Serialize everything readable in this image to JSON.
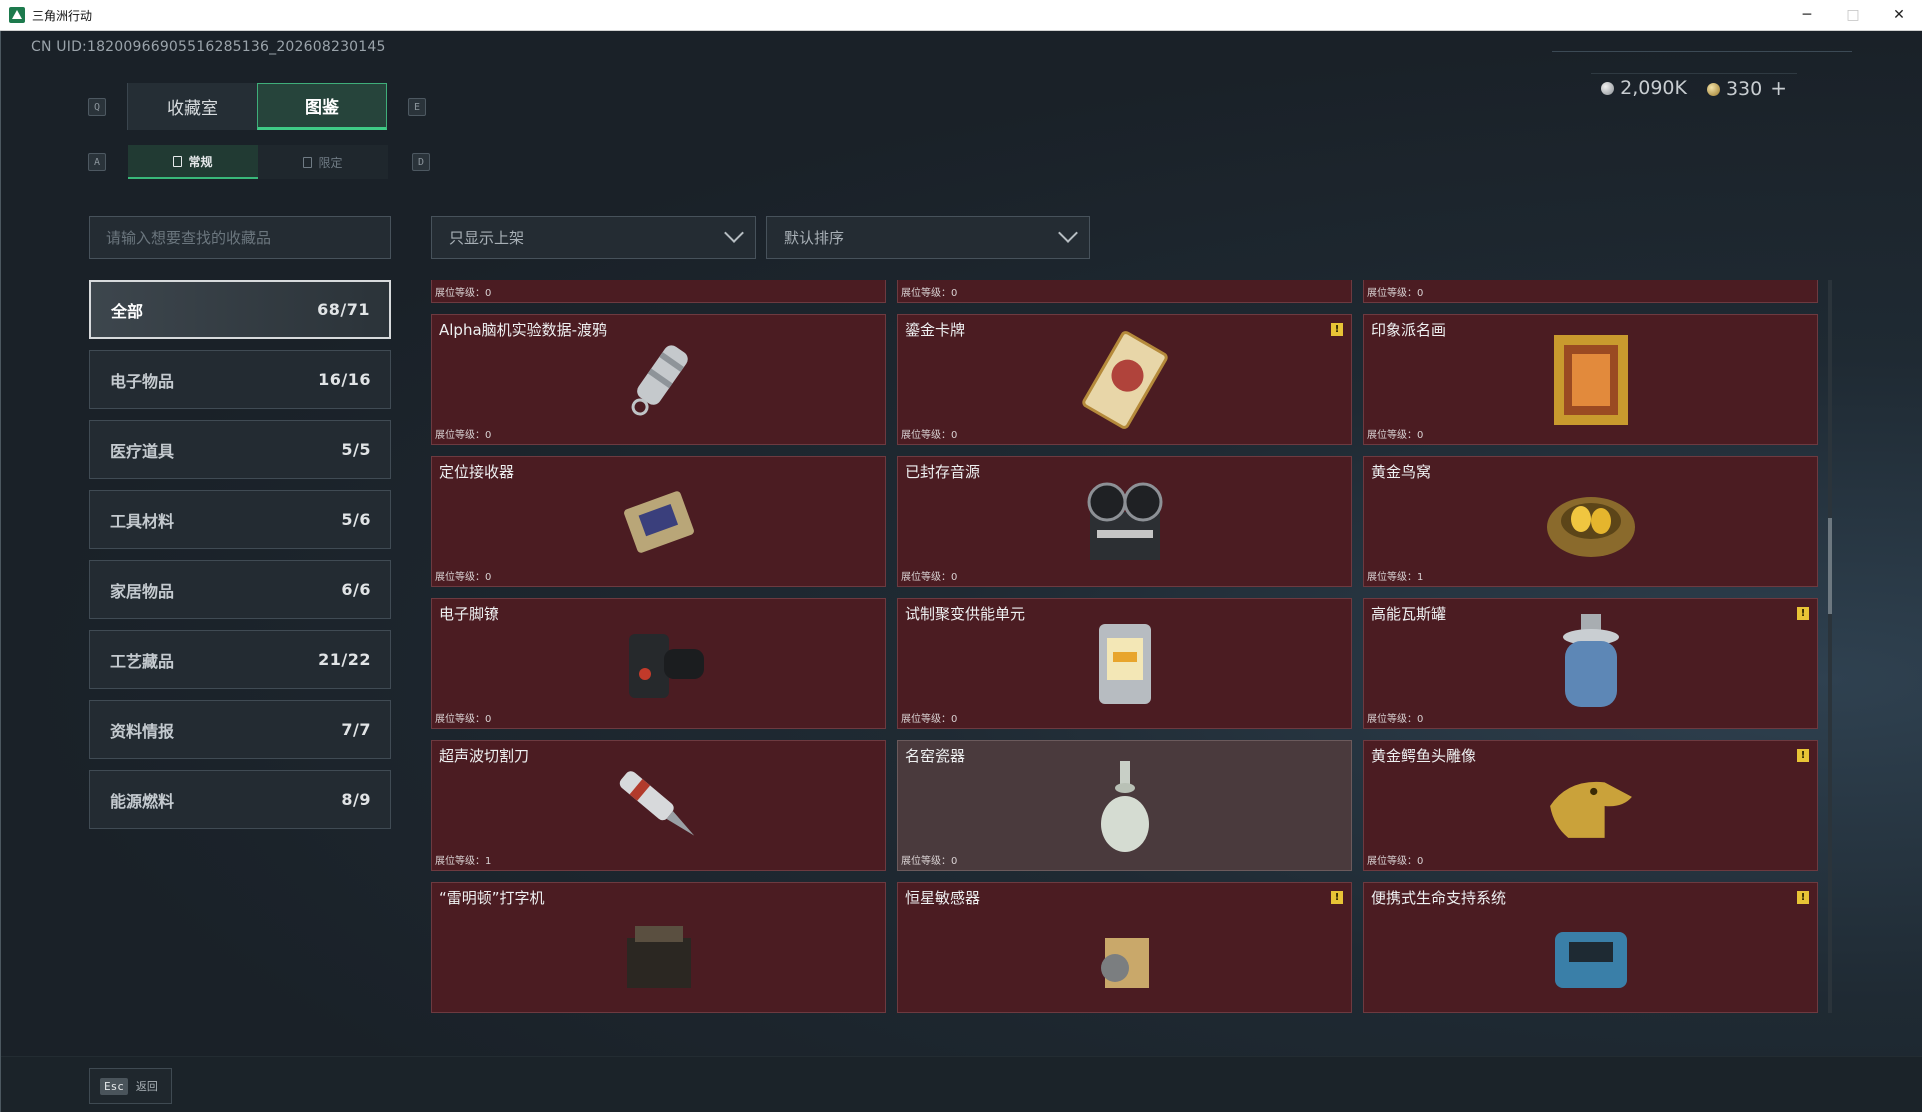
{
  "window": {
    "title": "三角洲行动",
    "controls": [
      "─",
      "□",
      "✕"
    ]
  },
  "header": {
    "uid": "CN UID:1820096690551628​5136_202608230145",
    "currency": [
      {
        "icon": "silver-coin-icon",
        "value": "2,090K"
      },
      {
        "icon": "gold-coin-icon",
        "value": "330"
      }
    ],
    "add_label": "+"
  },
  "tabs": {
    "main": [
      {
        "label": "收藏室",
        "active": false
      },
      {
        "label": "图鉴",
        "active": true
      }
    ],
    "main_keys": [
      "Q",
      "E"
    ],
    "sub": [
      {
        "label": "常规",
        "active": true
      },
      {
        "label": "限定",
        "active": false
      }
    ],
    "sub_keys": [
      "A",
      "D"
    ]
  },
  "filters": {
    "search_placeholder": "请输入想要查找的收藏品",
    "shelf_filter": "只显示上架",
    "sort": "默认排序"
  },
  "categories": [
    {
      "label": "全部",
      "count": "68/71",
      "active": true
    },
    {
      "label": "电子物品",
      "count": "16/16"
    },
    {
      "label": "医疗道具",
      "count": "5/5"
    },
    {
      "label": "工具材料",
      "count": "5/6"
    },
    {
      "label": "家居物品",
      "count": "6/6"
    },
    {
      "label": "工艺藏品",
      "count": "21/22"
    },
    {
      "label": "资料情报",
      "count": "7/7"
    },
    {
      "label": "能源燃料",
      "count": "8/9"
    }
  ],
  "level_label": "展位等级：",
  "items": [
    {
      "name": "",
      "level": "0",
      "warn": false,
      "icon": "caviar-tin-icon"
    },
    {
      "name": "",
      "level": "0",
      "warn": false,
      "icon": "robot-device-icon"
    },
    {
      "name": "",
      "level": "0",
      "warn": false,
      "icon": "blueprint-map-icon"
    },
    {
      "name": "Alpha脑机实验数据-渡鸦",
      "level": "0",
      "warn": false,
      "icon": "data-capsule-icon"
    },
    {
      "name": "鎏金卡牌",
      "level": "0",
      "warn": true,
      "icon": "gilded-card-icon"
    },
    {
      "name": "印象派名画",
      "level": "0",
      "warn": false,
      "icon": "framed-painting-icon"
    },
    {
      "name": "定位接收器",
      "level": "0",
      "warn": false,
      "icon": "receiver-icon"
    },
    {
      "name": "已封存音源",
      "level": "0",
      "warn": false,
      "icon": "reel-recorder-icon"
    },
    {
      "name": "黄金鸟窝",
      "level": "1",
      "warn": false,
      "icon": "golden-nest-icon"
    },
    {
      "name": "电子脚镣",
      "level": "0",
      "warn": false,
      "icon": "ankle-monitor-icon"
    },
    {
      "name": "试制聚变供能单元",
      "level": "0",
      "warn": false,
      "icon": "fusion-cell-icon"
    },
    {
      "name": "高能瓦斯罐",
      "level": "0",
      "warn": true,
      "icon": "gas-canister-icon"
    },
    {
      "name": "超声波切割刀",
      "level": "1",
      "warn": false,
      "icon": "ultrasonic-cutter-icon"
    },
    {
      "name": "名窑瓷器",
      "level": "0",
      "warn": false,
      "grey": true,
      "icon": "porcelain-vase-icon"
    },
    {
      "name": "黄金鳄鱼头雕像",
      "level": "0",
      "warn": true,
      "icon": "gold-crocodile-icon"
    },
    {
      "name": "“雷明顿”打字机",
      "level": "",
      "warn": false,
      "icon": "typewriter-icon"
    },
    {
      "name": "恒星敏感器",
      "level": "",
      "warn": true,
      "icon": "star-sensor-icon"
    },
    {
      "name": "便携式生命支持系统",
      "level": "",
      "warn": true,
      "icon": "life-support-icon"
    }
  ],
  "footer": {
    "esc_key": "Esc",
    "back_label": "返回"
  },
  "colors": {
    "accent": "#3fcb86",
    "card_bg": "#4b1c22",
    "warn": "#e8c436"
  }
}
